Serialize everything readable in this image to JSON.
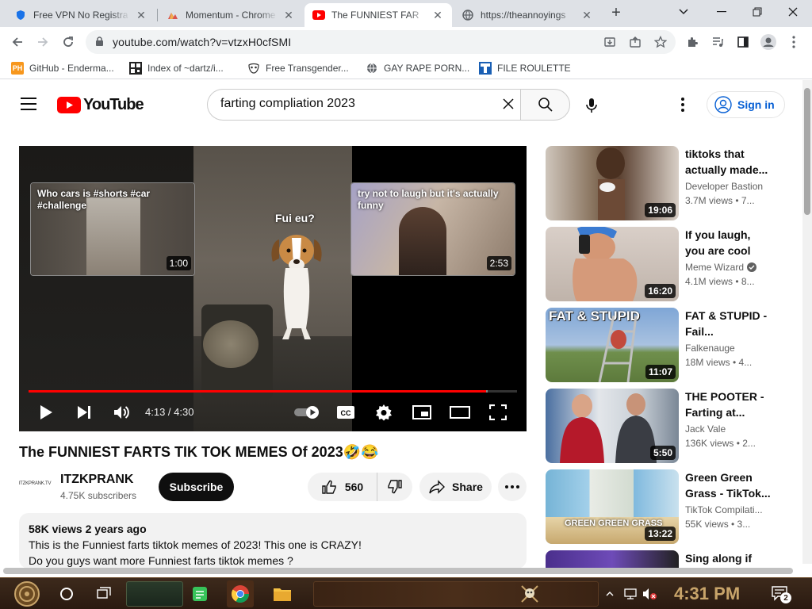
{
  "browser": {
    "tabs": [
      {
        "title": "Free VPN No Registra",
        "icon": "shield-icon",
        "active": false
      },
      {
        "title": "Momentum - Chrome W",
        "icon": "momentum-icon",
        "active": false
      },
      {
        "title": "The FUNNIEST FAR",
        "icon": "youtube-icon",
        "active": true
      },
      {
        "title": "https://theannoyings",
        "icon": "globe-icon",
        "active": false
      }
    ],
    "url": "youtube.com/watch?v=vtzxH0cfSMI",
    "bookmarks": [
      {
        "label": "GitHub - Enderma...",
        "icon": "ph-icon",
        "color": "#f7971d"
      },
      {
        "label": "Index of ~dartz/i...",
        "icon": "qr-icon",
        "color": "#222222"
      },
      {
        "label": "Free Transgender...",
        "icon": "mask-icon",
        "color": "#555555"
      },
      {
        "label": "GAY RAPE PORN...",
        "icon": "globe-icon",
        "color": "#5f6368"
      },
      {
        "label": "FILE ROULETTE",
        "icon": "file-roulette-icon",
        "color": "#1a5fb4"
      }
    ]
  },
  "youtube": {
    "logo_text": "YouTube",
    "search_value": "farting compliation 2023",
    "signin_label": "Sign in",
    "player": {
      "overlay_text": "Fui eu?",
      "endcards": [
        {
          "title": "Who cars is #shorts #car #challenge",
          "duration": "1:00"
        },
        {
          "title": "try not to laugh but it's actually funny",
          "duration": "2:53"
        }
      ],
      "time_display": "4:13 / 4:30",
      "progress": 0.936,
      "buffered": 0.94
    },
    "video_title": "The FUNNIEST FARTS TIK TOK MEMES Of 2023🤣😂",
    "channel": {
      "avatar_text": "ITZKPRANK.TV",
      "name": "ITZKPRANK",
      "subscribers": "4.75K subscribers"
    },
    "subscribe_label": "Subscribe",
    "like_count": "560",
    "share_label": "Share",
    "description": {
      "meta": "58K views  2 years ago",
      "line1": "This is the Funniest farts tiktok memes of 2023! This one is CRAZY!",
      "line2": "Do you guys want more Funniest farts tiktok memes ?"
    },
    "recommendations": [
      {
        "title": "tiktoks that actually made...",
        "channel": "Developer Bastion",
        "verified": false,
        "views": "3.7M views  • 7...",
        "duration": "19:06"
      },
      {
        "title": "If you laugh, you are cool",
        "channel": "Meme Wizard",
        "verified": true,
        "views": "4.1M views  • 8...",
        "duration": "16:20"
      },
      {
        "title": "FAT & STUPID - Fail...",
        "channel": "Falkenauge",
        "verified": false,
        "views": "18M views  • 4...",
        "duration": "11:07",
        "thumb_text": "FAT & STUPID"
      },
      {
        "title": "THE POOTER - Farting at...",
        "channel": "Jack Vale",
        "verified": false,
        "views": "136K views  • 2...",
        "duration": "5:50"
      },
      {
        "title": "Green Green Grass - TikTok...",
        "channel": "TikTok Compilati...",
        "verified": false,
        "views": "55K views  • 3...",
        "duration": "13:22",
        "thumb_text": "GREEN GREEN GRASS"
      },
      {
        "title": "Sing along if",
        "channel": "",
        "verified": false,
        "views": "",
        "duration": ""
      }
    ]
  },
  "taskbar": {
    "time": "4:31 PM",
    "notification_count": "2"
  },
  "colors": {
    "youtube_red": "#ff0000",
    "link_blue": "#065fd4",
    "taskbar_bg": "#2a1a10"
  }
}
